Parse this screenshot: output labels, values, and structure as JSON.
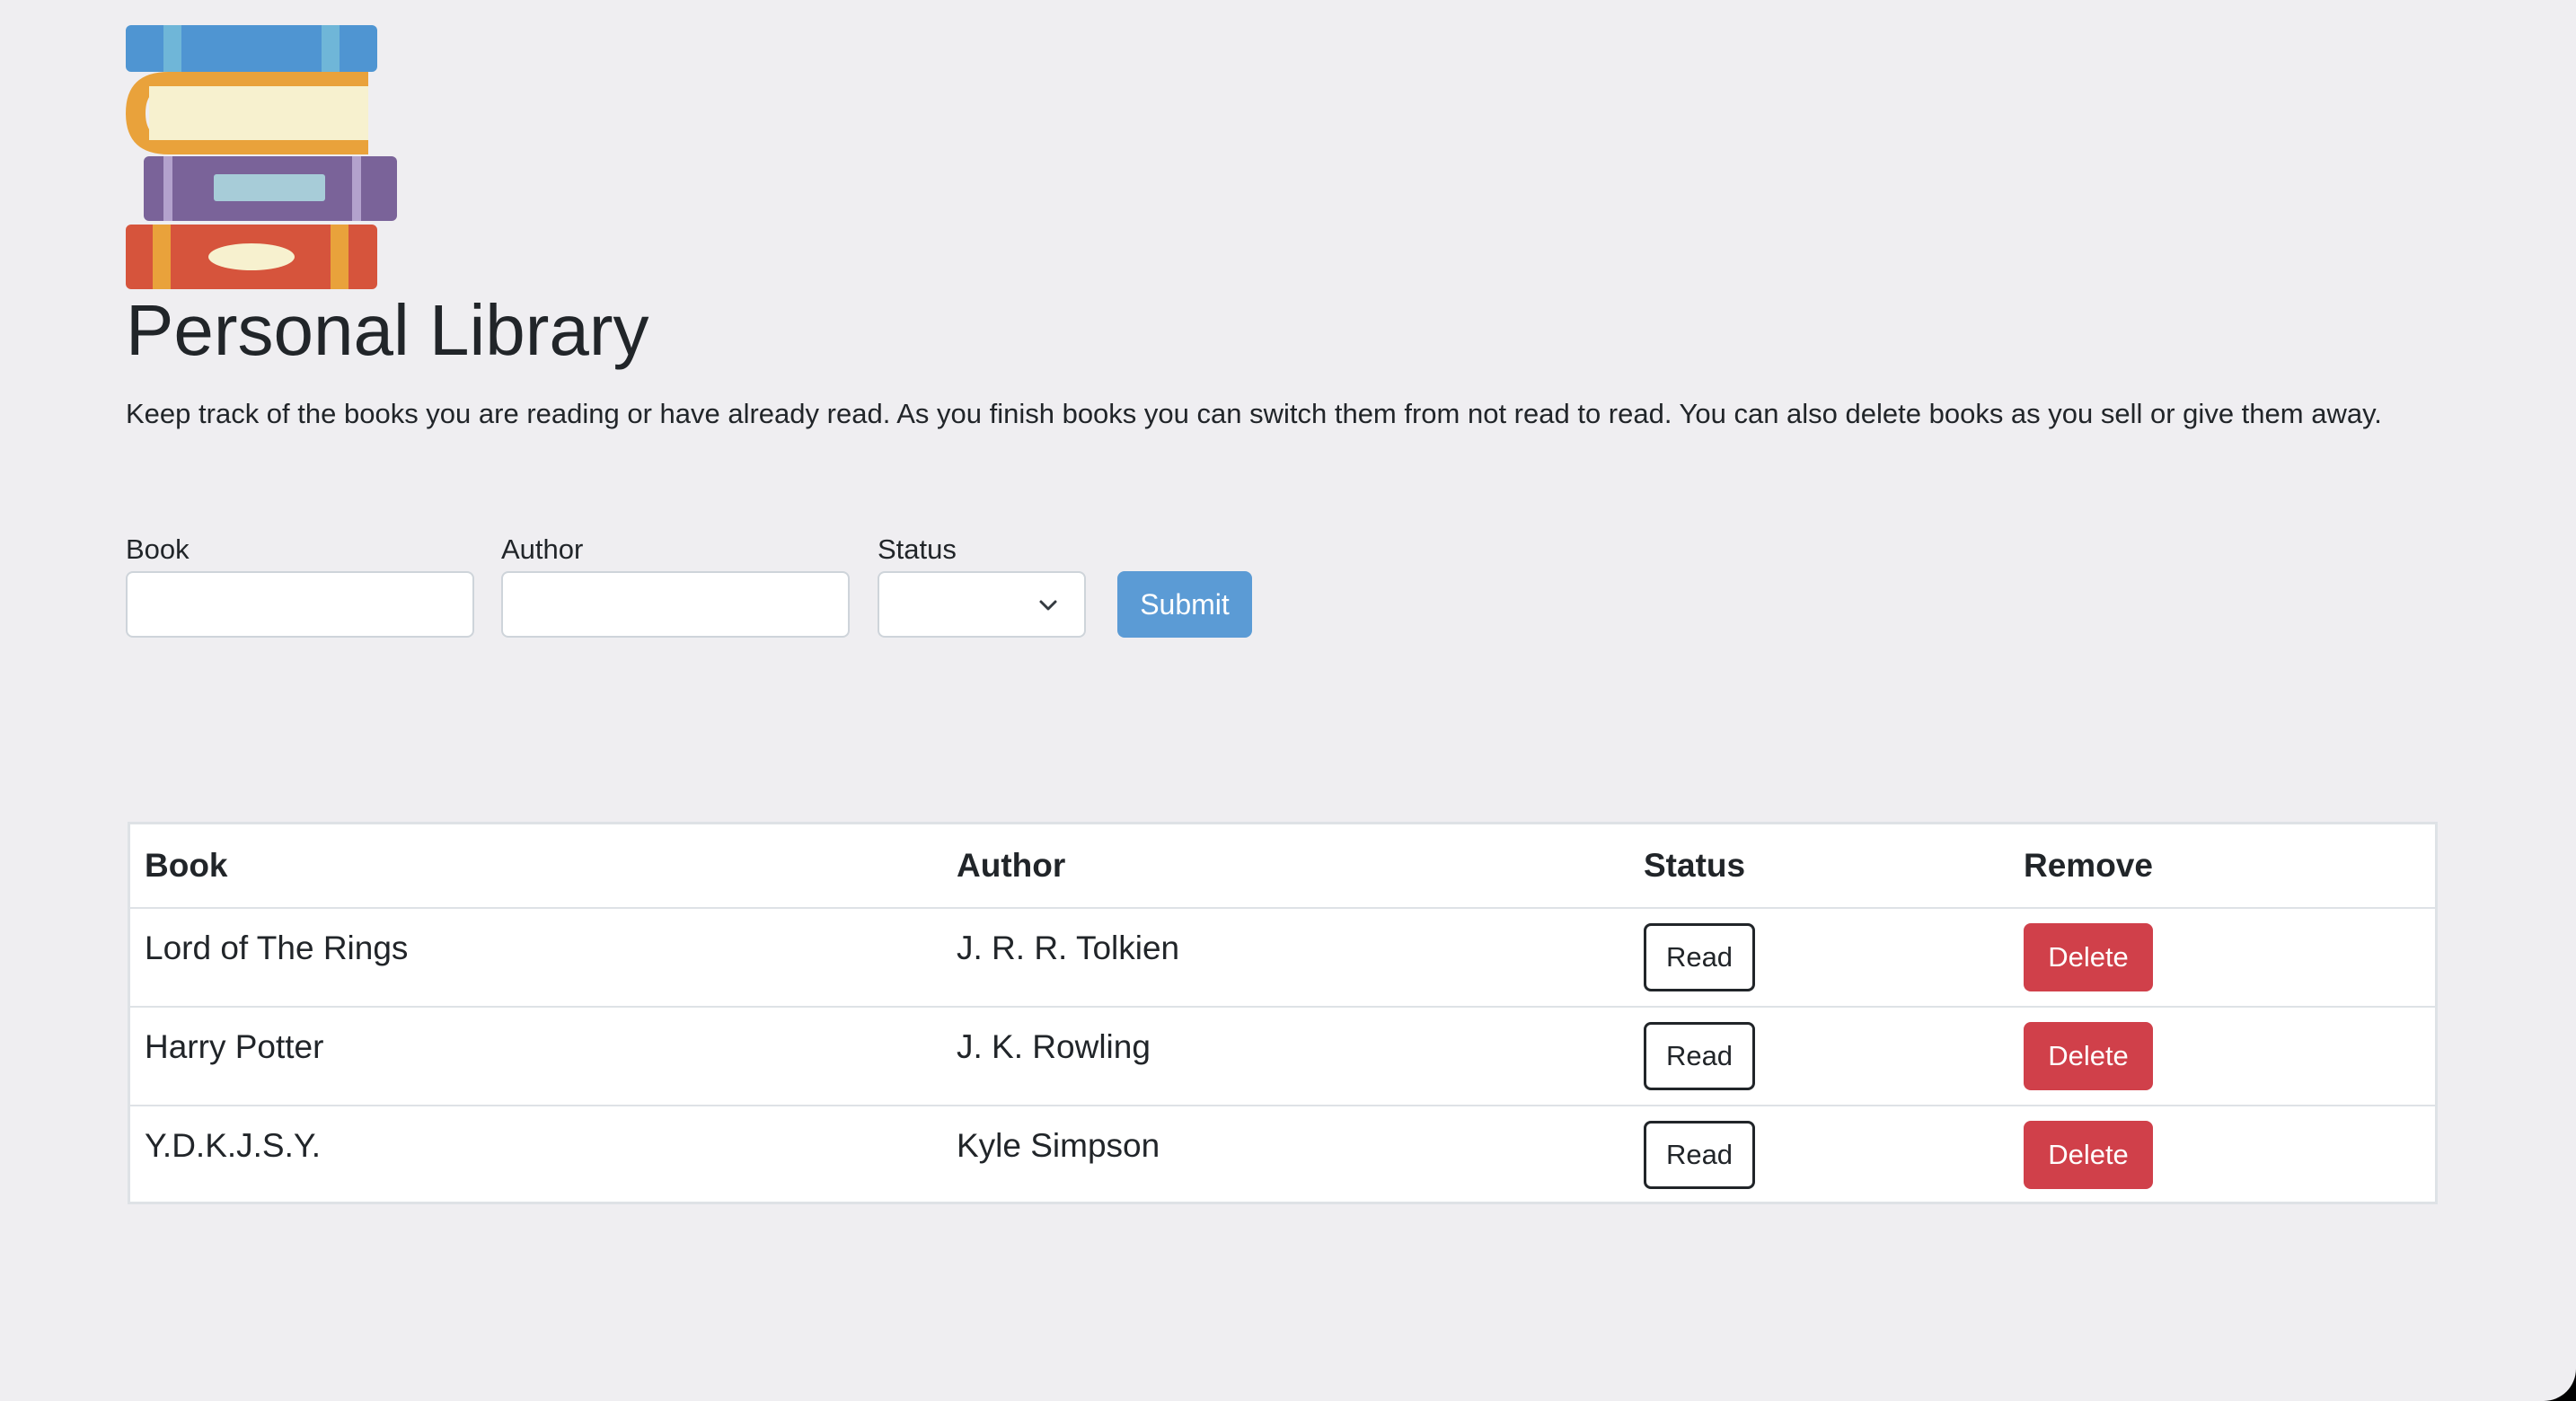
{
  "header": {
    "title": "Personal Library",
    "description": "Keep track of the books you are reading or have already read. As you finish books you can switch them from not read to read. You can also delete books as you sell or give them away."
  },
  "form": {
    "book_label": "Book",
    "book_value": "",
    "author_label": "Author",
    "author_value": "",
    "status_label": "Status",
    "status_value": "",
    "submit_label": "Submit"
  },
  "table": {
    "headers": [
      "Book",
      "Author",
      "Status",
      "Remove"
    ],
    "rows": [
      {
        "book": "Lord of The Rings",
        "author": "J. R. R. Tolkien",
        "status_label": "Read",
        "remove_label": "Delete"
      },
      {
        "book": "Harry Potter",
        "author": "J. K. Rowling",
        "status_label": "Read",
        "remove_label": "Delete"
      },
      {
        "book": "Y.D.K.J.S.Y.",
        "author": "Kyle Simpson",
        "status_label": "Read",
        "remove_label": "Delete"
      }
    ]
  },
  "icons": {
    "logo": "books-stack-icon",
    "select_arrow": "chevron-down-icon"
  },
  "colors": {
    "background": "#efeef1",
    "submit": "#5b9bd5",
    "delete": "#d0404a"
  }
}
